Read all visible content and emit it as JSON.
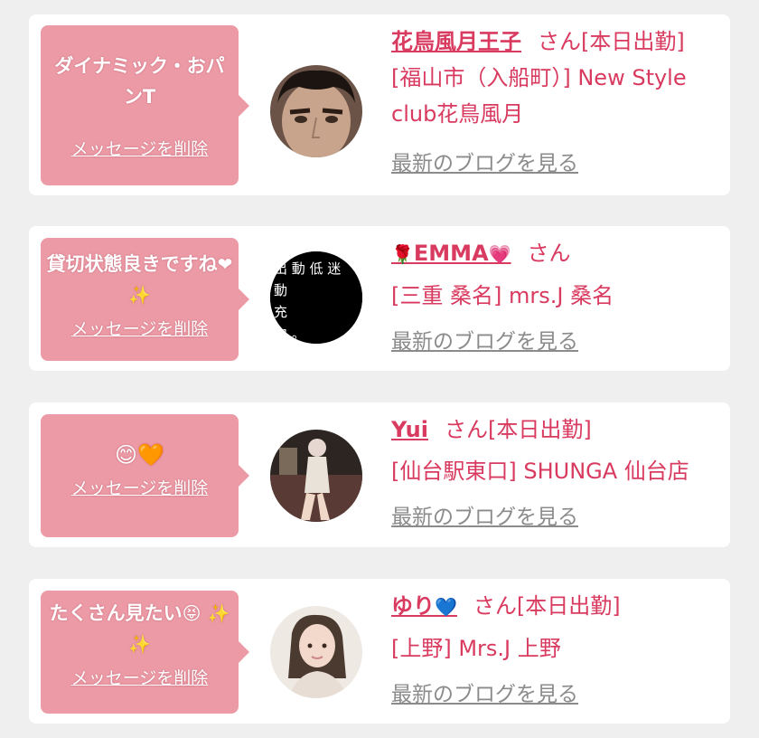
{
  "colors": {
    "bubble": "#ec9ba6",
    "text_pink": "#d93a5f",
    "link_gray": "#8b8b8b",
    "card": "#ffffff",
    "page": "#efefef"
  },
  "cards": [
    {
      "message": "ダイナミック・おパンT",
      "message_emoji": "",
      "delete_label": "メッセージを削除",
      "name": "花鳥風月王子",
      "name_emoji": "",
      "san": "さん[本日出勤]",
      "shop_line1": "[福山市（入船町）] New Style",
      "shop_line2": "club花鳥風月",
      "blog_label": "最新のブログを見る",
      "avatar_icon": "man-face-photo"
    },
    {
      "message": "貸切状態良きですね",
      "message_emoji": "❤ ✨",
      "delete_label": "メッセージを削除",
      "name": "EMMA",
      "name_prefix_emoji": "🌹",
      "name_emoji": "💗",
      "san": "さん",
      "shop_line1": "[三重 桑名] mrs.J 桑名",
      "shop_line2": "",
      "blog_label": "最新のブログを見る",
      "avatar_text": "出 動 低 迷 動 充 中。",
      "avatar_icon": "black-text-image"
    },
    {
      "message": "",
      "message_emoji": "😊🧡",
      "delete_label": "メッセージを削除",
      "name": "Yui",
      "name_emoji": "",
      "san": "さん[本日出勤]",
      "shop_line1": "[仙台駅東口] SHUNGA 仙台店",
      "shop_line2": "",
      "blog_label": "最新のブログを見る",
      "avatar_icon": "woman-sitting-photo"
    },
    {
      "message": "たくさん見たい",
      "message_emoji": "😝 ✨ ✨",
      "delete_label": "メッセージを削除",
      "name": "ゆり",
      "name_emoji": "💙",
      "san": "さん[本日出勤]",
      "shop_line1": "[上野] Mrs.J 上野",
      "shop_line2": "",
      "blog_label": "最新のブログを見る",
      "avatar_icon": "woman-portrait-photo"
    }
  ]
}
